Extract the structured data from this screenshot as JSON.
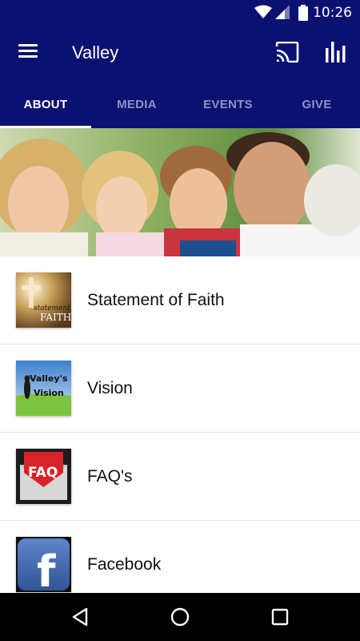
{
  "status_bar": {
    "time": "10:26",
    "icons": [
      "wifi-icon",
      "signal-icon",
      "battery-icon"
    ]
  },
  "app_bar": {
    "title": "Valley",
    "icons": [
      "menu-icon",
      "cast-icon",
      "stats-icon"
    ]
  },
  "tabs": [
    {
      "label": "ABOUT",
      "active": true
    },
    {
      "label": "MEDIA",
      "active": false
    },
    {
      "label": "EVENTS",
      "active": false
    },
    {
      "label": "GIVE",
      "active": false
    }
  ],
  "list": {
    "items": [
      {
        "label": "Statement of Faith",
        "thumb_line1": "statement",
        "thumb_line2": "FAITH"
      },
      {
        "label": "Vision",
        "thumb_line1": "Valley's",
        "thumb_line2": "Vision"
      },
      {
        "label": "FAQ's",
        "thumb_text": "FAQ"
      },
      {
        "label": "Facebook",
        "thumb_text": "f"
      }
    ]
  },
  "colors": {
    "primary": "#0b1170",
    "tab_inactive": "#8e93c5",
    "nav_bar": "#000000"
  }
}
